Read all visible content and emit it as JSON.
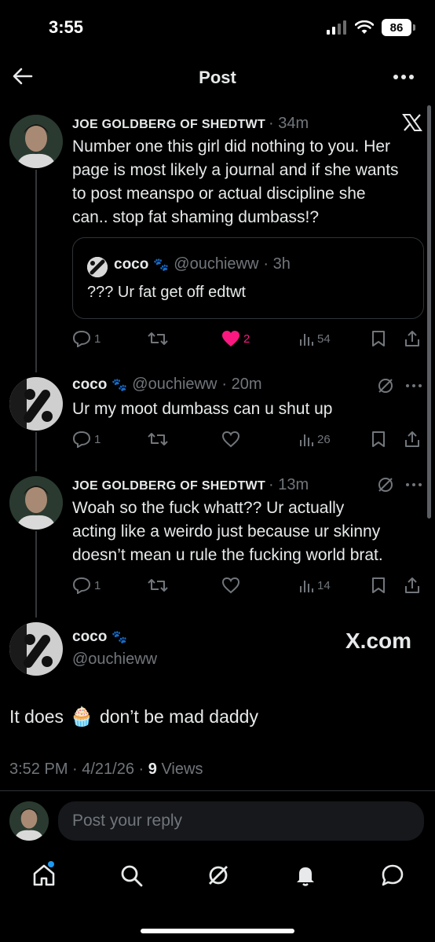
{
  "status_bar": {
    "time": "3:55",
    "battery": "86"
  },
  "header": {
    "title": "Post"
  },
  "tweets": [
    {
      "author": "JOE GOLDBERG OF SHEDTWT",
      "time": "· 34m",
      "text_lines": [
        "Number one this girl did nothing to you. Her",
        "page is most likely a journal and if she wants",
        "to post meanspo or actual discipline she",
        "can.. stop fat shaming dumbass!?"
      ],
      "quote": {
        "author": "coco",
        "handle": "@ouchieww",
        "time": "· 3h",
        "text": "??? Ur fat get off edtwt"
      },
      "replies": "1",
      "likes": "2",
      "views": "54"
    },
    {
      "author": "coco",
      "handle": "@ouchieww",
      "time": "· 20m",
      "text_lines": [
        "Ur my moot dumbass can u shut up"
      ],
      "replies": "1",
      "views": "26"
    },
    {
      "author": "JOE GOLDBERG OF SHEDTWT",
      "time": "· 13m",
      "text_lines": [
        "Woah so the fuck whatt?? Ur actually",
        "acting like a weirdo just because ur skinny",
        "doesn’t mean u rule the fucking world brat."
      ],
      "replies": "1",
      "views": "14"
    }
  ],
  "main_post": {
    "author": "coco",
    "handle": "@ouchieww",
    "watermark": "X.com",
    "text_before": "It does",
    "text_after": "don’t be mad daddy",
    "timestamp": "3:52 PM · 4/21/26 · ",
    "views_count": "9",
    "views_label": "Views"
  },
  "reply_box": {
    "placeholder": "Post your reply"
  },
  "colors": {
    "accent": "#1d9bf0",
    "like": "#f91880",
    "text": "#e7e9ea",
    "muted": "#71767b"
  }
}
